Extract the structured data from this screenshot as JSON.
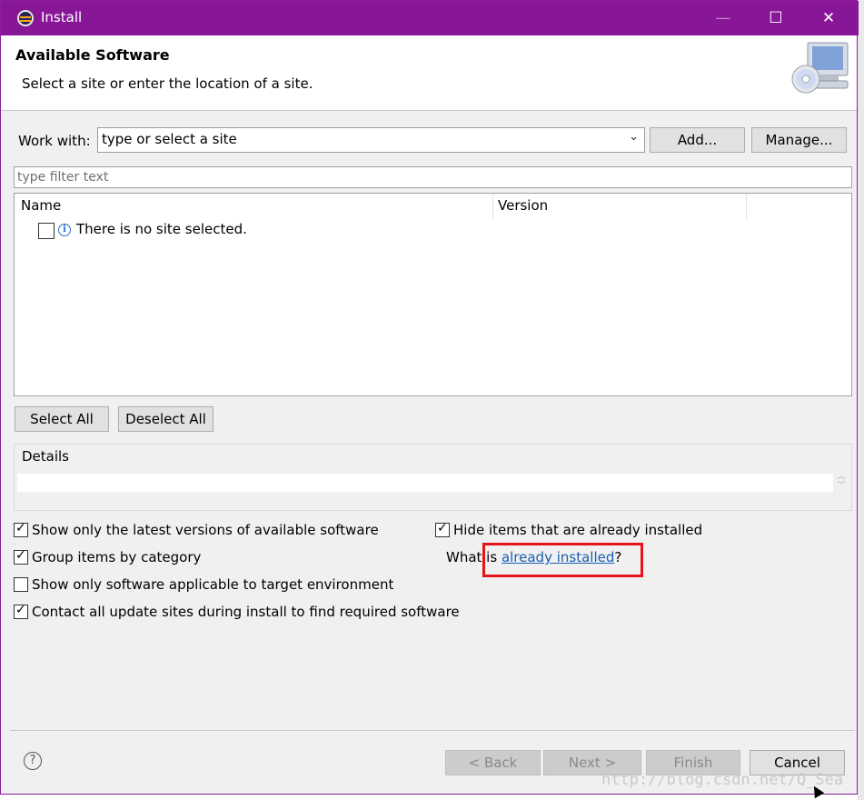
{
  "window": {
    "title": "Install",
    "minimize": "—",
    "maximize": "☐",
    "close": "✕"
  },
  "header": {
    "title": "Available Software",
    "subtitle": "Select a site or enter the location of a site."
  },
  "work_with": {
    "label": "Work with:",
    "value": "type or select a site",
    "add_button": "Add...",
    "manage_button": "Manage..."
  },
  "filter": {
    "placeholder": "type filter text"
  },
  "table": {
    "columns": [
      "Name",
      "Version"
    ],
    "rows": [
      {
        "text": "There is no site selected.",
        "checked": false
      }
    ]
  },
  "selection": {
    "select_all": "Select All",
    "deselect_all": "Deselect All"
  },
  "details": {
    "label": "Details"
  },
  "options": {
    "latest_versions": "Show only the latest versions of available software",
    "group_by_category": "Group items by category",
    "target_env": "Show only software applicable to target environment",
    "contact_sites": "Contact all update sites during install to find required software",
    "hide_installed": "Hide items that are already installed",
    "what_is_prefix": "What is ",
    "already_installed_link": "already installed",
    "what_is_suffix": "?"
  },
  "footer": {
    "back": "< Back",
    "next": "Next >",
    "finish": "Finish",
    "cancel": "Cancel",
    "help": "?"
  },
  "watermark": "http://blog.csdn.net/Q_Sea",
  "colors": {
    "titlebar": "#881798",
    "highlight": "#e5131b",
    "link": "#1a5fb4"
  }
}
